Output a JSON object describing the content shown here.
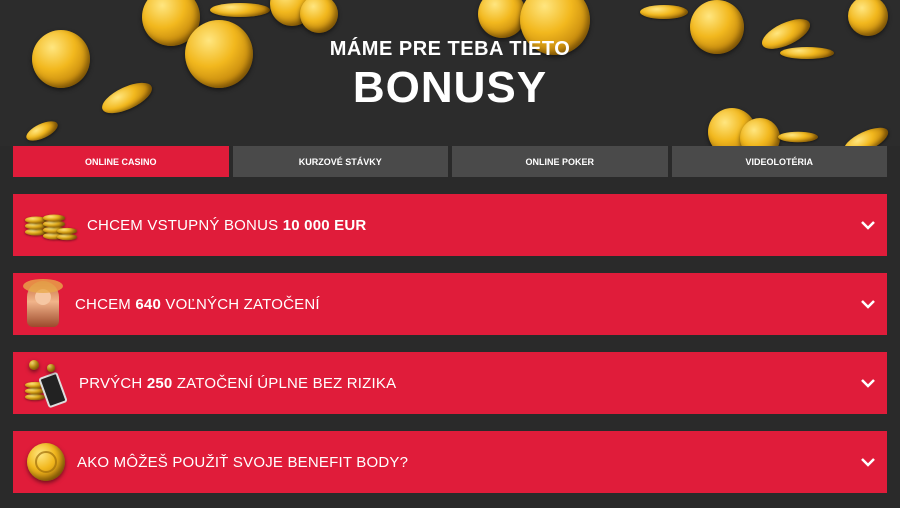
{
  "hero": {
    "subtitle": "MÁME PRE TEBA TIETO",
    "title": "BONUSY"
  },
  "tabs": [
    {
      "label": "ONLINE CASINO",
      "active": true
    },
    {
      "label": "KURZOVÉ STÁVKY",
      "active": false
    },
    {
      "label": "ONLINE POKER",
      "active": false
    },
    {
      "label": "VIDEOLOTÉRIA",
      "active": false
    }
  ],
  "accordion": [
    {
      "pre": "CHCEM VSTUPNÝ BONUS ",
      "bold": "10 000 EUR",
      "post": "",
      "icon": "coin-stack-icon"
    },
    {
      "pre": "CHCEM ",
      "bold": "640",
      "post": " VOĽNÝCH ZATOČENÍ",
      "icon": "slot-character-icon"
    },
    {
      "pre": "PRVÝCH ",
      "bold": "250",
      "post": " ZATOČENÍ ÚPLNE BEZ RIZIKA",
      "icon": "phone-coins-icon"
    },
    {
      "pre": "AKO MÔŽEŠ POUŽIŤ SVOJE BENEFIT BODY?",
      "bold": "",
      "post": "",
      "icon": "gold-coin-icon"
    }
  ],
  "colors": {
    "accent": "#e01c3a",
    "tab_inactive": "#4a4a4a",
    "background": "#2a2a2a"
  }
}
